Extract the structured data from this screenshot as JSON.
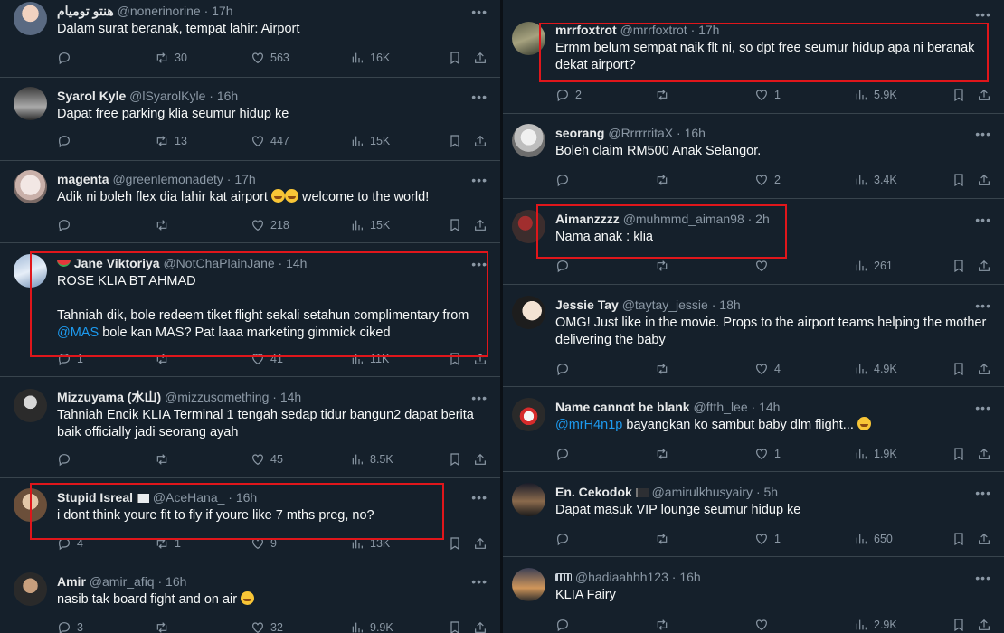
{
  "left_tweets": [
    {
      "name": "هنتو توميام",
      "handle": "@nonerinorine",
      "time": "· 17h",
      "lines": [
        "Dalam surat beranak, tempat lahir: Airport"
      ],
      "reply": "",
      "retweet": "30",
      "like": "563",
      "views": "16K"
    },
    {
      "name": "Syarol Kyle",
      "handle": "@lSyarolKyle",
      "time": "· 16h",
      "lines": [
        "Dapat free parking klia seumur hidup ke"
      ],
      "reply": "",
      "retweet": "13",
      "like": "447",
      "views": "15K"
    },
    {
      "name": "magenta",
      "handle": "@greenlemonadety",
      "time": "· 17h",
      "lines": [
        "Adik ni boleh flex dia lahir kat airport",
        "welcome to the world!"
      ],
      "reply": "",
      "retweet": "",
      "like": "218",
      "views": "15K"
    },
    {
      "name": "Jane Viktoriya",
      "handle": "@NotChaPlainJane",
      "time": "· 14h",
      "lines": [
        "ROSE KLIA BT AHMAD",
        "",
        "Tahniah dik, bole redeem tiket flight sekali setahun complimentary from",
        "@MAS",
        "bole kan MAS? Pat laaa marketing gimmick ciked"
      ],
      "reply": "1",
      "retweet": "",
      "like": "41",
      "views": "11K"
    },
    {
      "name": "Mizzuyama (水山)",
      "handle": "@mizzusomething",
      "time": "· 14h",
      "lines": [
        "Tahniah Encik KLIA Terminal 1 tengah sedap tidur bangun2 dapat berita",
        "baik officially jadi seorang ayah"
      ],
      "reply": "",
      "retweet": "",
      "like": "45",
      "views": "8.5K"
    },
    {
      "name": "Stupid Isreal",
      "handle": "@AceHana_",
      "time": "· 16h",
      "lines": [
        "i dont think youre fit to fly if youre like 7 mths preg, no?"
      ],
      "reply": "4",
      "retweet": "1",
      "like": "9",
      "views": "13K"
    },
    {
      "name": "Amir",
      "handle": "@amir_afiq",
      "time": "· 16h",
      "lines": [
        "nasib tak board fight and on air"
      ],
      "reply": "3",
      "retweet": "",
      "like": "32",
      "views": "9.9K"
    }
  ],
  "right_tweets": [
    {
      "name": "mrrfoxtrot",
      "handle": "@mrrfoxtrot",
      "time": "· 17h",
      "lines": [
        "Ermm belum sempat naik flt ni, so dpt free seumur hidup apa ni beranak",
        "dekat airport?"
      ],
      "reply": "2",
      "retweet": "",
      "like": "1",
      "views": "5.9K"
    },
    {
      "name": "seorang",
      "handle": "@RrrrrritaX",
      "time": "· 16h",
      "lines": [
        "Boleh claim RM500 Anak Selangor."
      ],
      "reply": "",
      "retweet": "",
      "like": "2",
      "views": "3.4K"
    },
    {
      "name": "Aimanzzzz",
      "handle": "@muhmmd_aiman98",
      "time": "· 2h",
      "lines": [
        "Nama anak : klia"
      ],
      "reply": "",
      "retweet": "",
      "like": "",
      "views": "261"
    },
    {
      "name": "Jessie Tay",
      "handle": "@taytay_jessie",
      "time": "· 18h",
      "lines": [
        "OMG! Just like in the movie. Props to the airport teams helping the mother",
        "delivering the baby"
      ],
      "reply": "",
      "retweet": "",
      "like": "4",
      "views": "4.9K"
    },
    {
      "name": "Name cannot be blank",
      "handle": "@ftth_lee",
      "time": "· 14h",
      "lines": [
        "@mrH4n1p",
        "bayangkan ko sambut baby dlm flight..."
      ],
      "reply": "",
      "retweet": "",
      "like": "1",
      "views": "1.9K"
    },
    {
      "name": "En. Cekodok",
      "handle": "@amirulkhusyairy",
      "time": "· 5h",
      "lines": [
        "Dapat masuk VIP lounge seumur hidup ke"
      ],
      "reply": "",
      "retweet": "",
      "like": "1",
      "views": "650"
    },
    {
      "name": "",
      "handle": "@hadiaahhh123",
      "time": "· 16h",
      "lines": [
        "KLIA Fairy"
      ],
      "reply": "",
      "retweet": "",
      "like": "",
      "views": "2.9K"
    }
  ],
  "colors": {
    "background": "#15202b",
    "text": "#f7f9f9",
    "muted": "#8b98a5",
    "link": "#1d9bf0",
    "highlight_box": "#e0161b"
  },
  "icons": [
    "reply-icon",
    "retweet-icon",
    "like-icon",
    "views-icon",
    "bookmark-icon",
    "share-icon",
    "more-icon"
  ]
}
